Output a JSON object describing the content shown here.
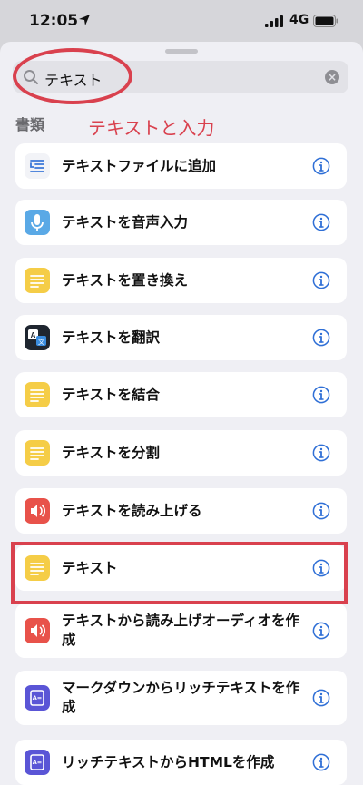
{
  "status": {
    "time": "12:05",
    "network": "4G"
  },
  "search": {
    "query": "テキスト"
  },
  "section": {
    "title": "書類"
  },
  "annotation": "テキストと入力",
  "items": [
    {
      "label": "テキストファイルに追加",
      "icon": "text-file-append-icon",
      "color": "#f2f3f7"
    },
    {
      "label": "テキストを音声入力",
      "icon": "microphone-icon",
      "color": "#5aa9e6"
    },
    {
      "label": "テキストを置き換え",
      "icon": "document-lines-icon",
      "color": "#f5cd47"
    },
    {
      "label": "テキストを翻訳",
      "icon": "translate-icon",
      "color": "#1f2630"
    },
    {
      "label": "テキストを結合",
      "icon": "document-lines-icon",
      "color": "#f5cd47"
    },
    {
      "label": "テキストを分割",
      "icon": "document-lines-icon",
      "color": "#f5cd47"
    },
    {
      "label": "テキストを読み上げる",
      "icon": "speaker-icon",
      "color": "#e8524a"
    },
    {
      "label": "テキスト",
      "icon": "document-lines-icon",
      "color": "#f5cd47"
    },
    {
      "label": "テキストから読み上げオーディオを作成",
      "icon": "speaker-icon",
      "color": "#e8524a"
    },
    {
      "label": "マークダウンからリッチテキストを作成",
      "icon": "rich-text-icon",
      "color": "#5a55d6"
    },
    {
      "label": "リッチテキストからHTMLを作成",
      "icon": "rich-text-icon",
      "color": "#5a55d6"
    }
  ]
}
